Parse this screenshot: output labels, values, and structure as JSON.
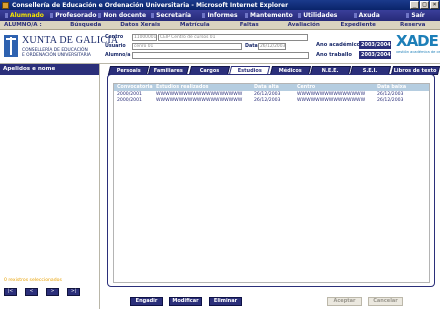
{
  "window": {
    "title": "Consellería de Educación e Ordenación Universitaria - Microsoft Internet Explorer",
    "min": "_",
    "max": "□",
    "close": "×"
  },
  "menu": {
    "items": [
      "Alumnado",
      "Profesorado",
      "Non docente",
      "Secretaría",
      "Informes",
      "Mantemento",
      "Utilidades",
      "Axuda",
      "Saír"
    ],
    "active": "Alumnado"
  },
  "submenu": {
    "items": [
      "ALUMNO/A :",
      "Búsqueda",
      "Datos Xerais",
      "Matrícula",
      "Faltas",
      "Avaliación",
      "Expediente",
      "Reserva"
    ]
  },
  "header": {
    "brand": "XUNTA DE GALICIA",
    "dept_line1": "CONSELLERÍA DE EDUCACIÓN",
    "dept_line2": "E ORDENACIÓN UNIVERSITARIA",
    "centro_label": "Centro",
    "centro_code": "11000001",
    "centro_name": "CEIP Centro de cursos 01",
    "usuario_label": "Usuario",
    "usuario_value": "cenro 01",
    "data_label": "Data",
    "data_value": "26/12/2003",
    "alumno_label": "Alumno/a",
    "ano_academico_label": "Ano académico",
    "ano_academico_value": "2003/2004",
    "ano_traballo_label": "Ano traballo",
    "ano_traballo_value": "2003/2004",
    "xade_mark": "XADE",
    "xade_sub": "xestión académica de centros"
  },
  "left": {
    "header": "Apelidos e nome",
    "count": "0 rexistros seleccionados",
    "nav": [
      "|<",
      "<",
      ">",
      ">|"
    ]
  },
  "tabs": {
    "items": [
      "Persoais",
      "Familiares",
      "Cargos",
      "Estudios",
      "Médicos",
      "N.E.E.",
      "S.E.I.",
      "Libros de texto"
    ],
    "active": "Estudios"
  },
  "grid": {
    "columns": [
      "Convocatoria",
      "Estudios realizados",
      "Data alta",
      "Centro",
      "Data baixa"
    ],
    "rows": [
      [
        "2000/2001",
        "WWWWWWWWWWWWWWWWWWW",
        "26/12/2003",
        "WWWWWWWWWWWWWWW",
        "26/12/2003"
      ],
      [
        "2000/2001",
        "WWWWWWWWWWWWWWWWWWW",
        "26/12/2003",
        "WWWWWWWWWWWWWWW",
        "26/12/2003"
      ]
    ]
  },
  "buttons": {
    "engadir": "Engadir",
    "modificar": "Modificar",
    "eliminar": "Eliminar",
    "aceptar": "Aceptar",
    "cancelar": "Cancelar"
  },
  "colors": {
    "navy": "#2b2f7a",
    "highlight": "#f4e400",
    "tan": "#d9d3bf",
    "grid_header": "#b5cde0"
  }
}
